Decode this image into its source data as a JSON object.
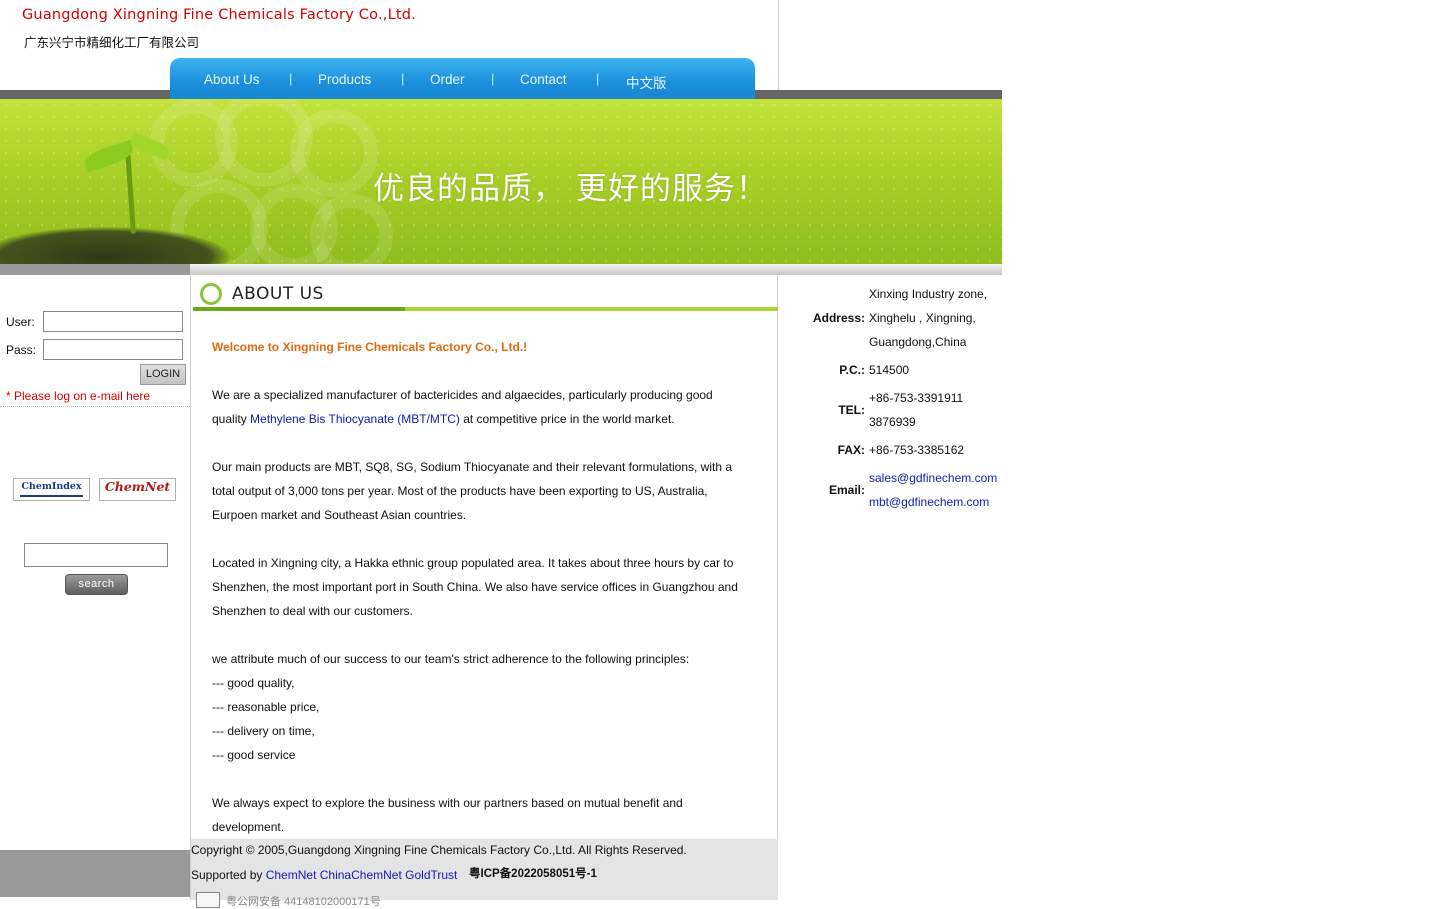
{
  "header": {
    "title_en": "Guangdong Xingning Fine Chemicals Factory Co.,Ltd.",
    "title_cn": "广东兴宁市精细化工厂有限公司"
  },
  "nav": {
    "items": [
      "About Us",
      "Products",
      "Order",
      "Contact",
      "中文版"
    ],
    "separator": "|"
  },
  "banner": {
    "slogan": "优良的品质，  更好的服务！"
  },
  "login": {
    "user_label": "User:",
    "pass_label": "Pass:",
    "button_label": "LOGIN",
    "hint": "* Please log on e-mail here"
  },
  "partners": {
    "chemindex": "ChemIndex",
    "chemnet": "ChemNet"
  },
  "search": {
    "button_label": "search"
  },
  "about": {
    "section_title": "ABOUT US",
    "welcome": "Welcome to Xingning Fine Chemicals Factory Co., Ltd.!",
    "p1_line1": "We are a specialized manufacturer of bactericides and algaecides, particularly producing good",
    "p1_line2_pre": "quality ",
    "p1_link": "Methylene Bis Thiocyanate (MBT/MTC)",
    "p1_line2_post": " at competitive price in the world market.",
    "p2_line1": "Our main products are MBT, SQ8, SG, Sodium Thiocyanate and their relevant formulations, with a",
    "p2_line2": "total output of 3,000 tons per year. Most of the products have been exporting to US, Australia,",
    "p2_line3": "Eurpoen market and Southeast Asian countries.",
    "p3_line1": "Located in Xingning city, a Hakka ethnic group populated area. It takes about three hours by car to",
    "p3_line2": "Shenzhen, the most important port in South China. We also have service offices in Guangzhou and",
    "p3_line3": "Shenzhen to deal with our customers.",
    "p4_line1": "we attribute much of our success to our team's strict adherence to the following principles:",
    "principles": [
      "--- good quality,",
      "--- reasonable price,",
      "--- delivery on time,",
      "--- good service"
    ],
    "p5_line1": "We always expect to explore the business with our partners based on mutual benefit and",
    "p5_line2": "development."
  },
  "contact": {
    "address_label": "Address:",
    "address_lines": [
      "Xinxing Industry zone,",
      "Xinghelu , Xingning,",
      "Guangdong,China"
    ],
    "pc_label": "P.C.:",
    "pc": "514500",
    "tel_label": "TEL:",
    "tel_lines": [
      "+86-753-3391911",
      "3876939"
    ],
    "fax_label": "FAX:",
    "fax": "+86-753-3385162",
    "email_label": "Email:",
    "emails": [
      "sales@gdfinechem.com",
      "mbt@gdfinechem.com"
    ]
  },
  "footer": {
    "copyright": "Copyright © 2005,Guangdong Xingning Fine Chemicals Factory Co.,Ltd. All Rights Reserved.",
    "supported_by": "Supported by ",
    "support_links": [
      "ChemNet",
      "ChinaChemNet",
      "GoldTrust"
    ],
    "icp": "粤ICP备2022058051号-1",
    "police": "粤公网安备 44148102000171号"
  }
}
